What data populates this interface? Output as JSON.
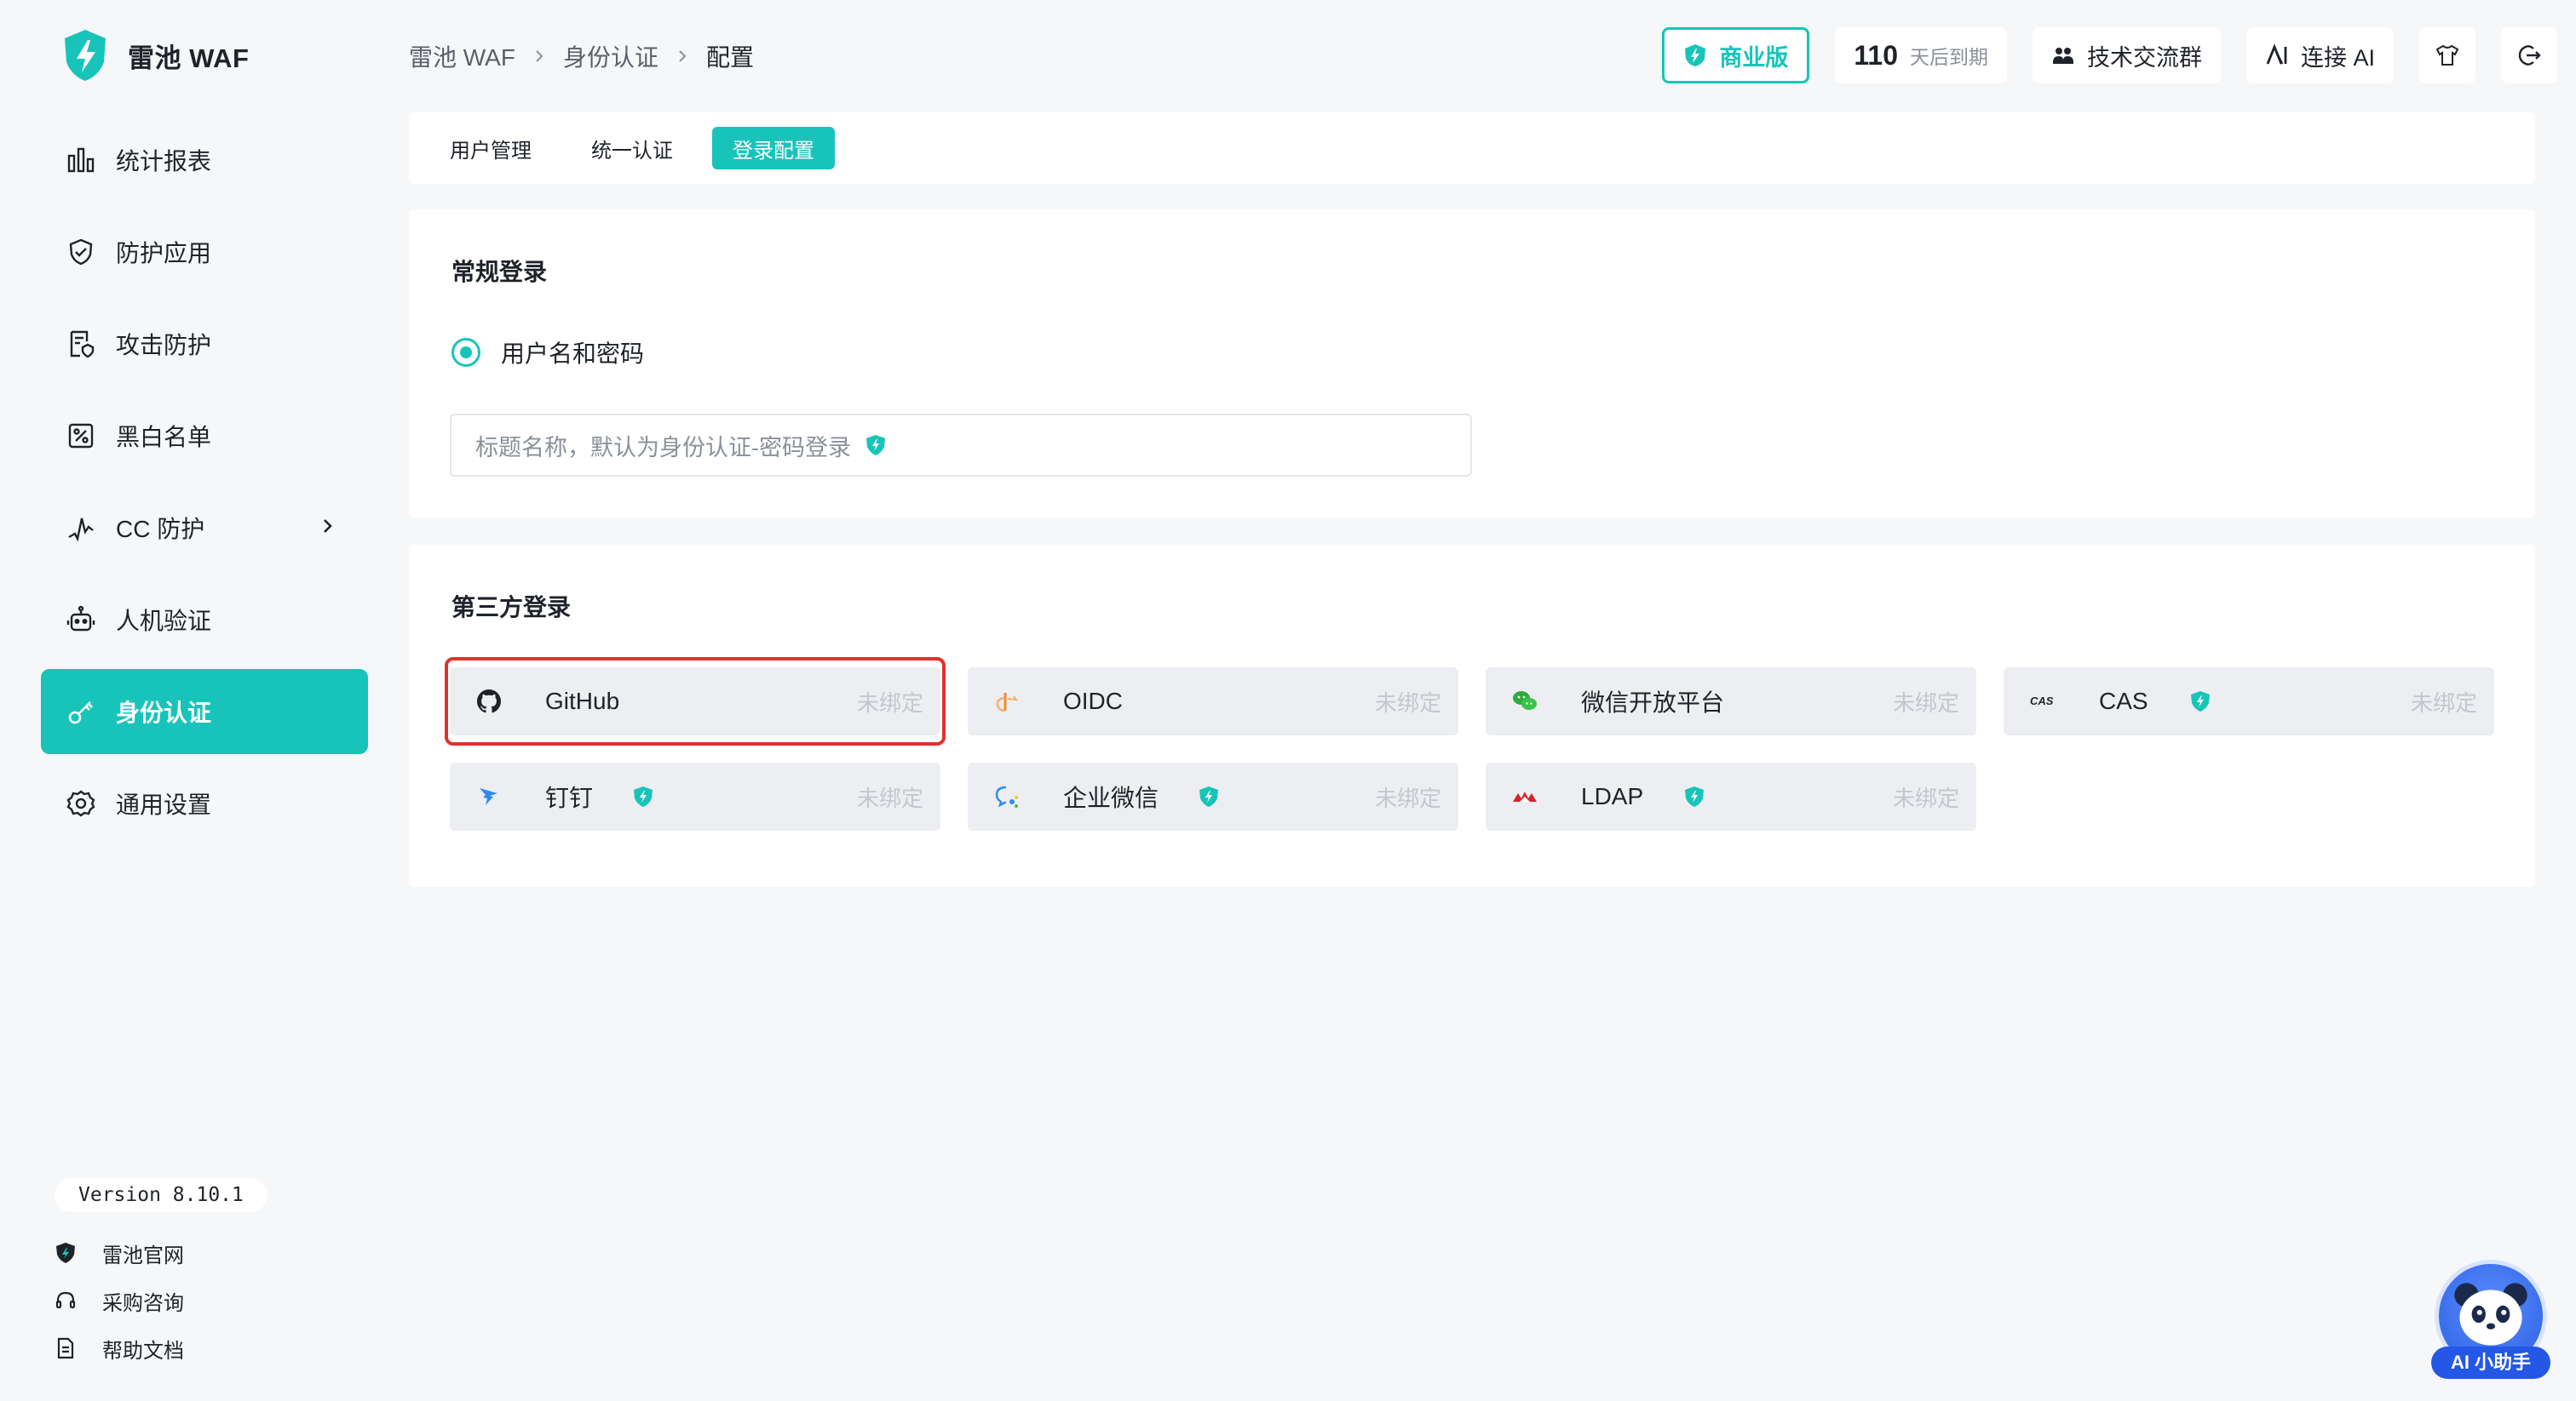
{
  "brand": {
    "name": "雷池 WAF",
    "color": "#18c4b9"
  },
  "sidebar": {
    "items": [
      {
        "label": "统计报表",
        "icon": "chart-icon"
      },
      {
        "label": "防护应用",
        "icon": "shield-icon"
      },
      {
        "label": "攻击防护",
        "icon": "document-shield-icon"
      },
      {
        "label": "黑白名单",
        "icon": "list-percent-icon"
      },
      {
        "label": "CC 防护",
        "icon": "pulse-icon"
      },
      {
        "label": "人机验证",
        "icon": "robot-icon"
      },
      {
        "label": "身份认证",
        "icon": "key-icon"
      },
      {
        "label": "通用设置",
        "icon": "settings-icon"
      }
    ],
    "active_index": 6,
    "version": "Version 8.10.1",
    "links": [
      {
        "label": "雷池官网",
        "icon": "shield-logo-icon"
      },
      {
        "label": "采购咨询",
        "icon": "headset-icon"
      },
      {
        "label": "帮助文档",
        "icon": "doc-icon"
      }
    ]
  },
  "breadcrumb": [
    "雷池 WAF",
    "身份认证",
    "配置"
  ],
  "topbar": {
    "edition": "商业版",
    "days_count": "110",
    "days_label": "天后到期",
    "community": "技术交流群",
    "connect_ai": "连接 AI"
  },
  "tabs": [
    "用户管理",
    "统一认证",
    "登录配置"
  ],
  "active_tab": 2,
  "regular_login": {
    "title": "常规登录",
    "option": "用户名和密码",
    "input_placeholder": "标题名称，默认为身份认证-密码登录"
  },
  "third_party": {
    "title": "第三方登录",
    "providers": [
      {
        "name": "GitHub",
        "status": "未绑定",
        "icon": "github-icon",
        "pro": false,
        "highlighted": true
      },
      {
        "name": "OIDC",
        "status": "未绑定",
        "icon": "oidc-icon",
        "pro": false
      },
      {
        "name": "微信开放平台",
        "status": "未绑定",
        "icon": "wechat-icon",
        "pro": false
      },
      {
        "name": "CAS",
        "status": "未绑定",
        "icon": "cas-icon",
        "pro": true
      },
      {
        "name": "钉钉",
        "status": "未绑定",
        "icon": "dingtalk-icon",
        "pro": true
      },
      {
        "name": "企业微信",
        "status": "未绑定",
        "icon": "wecom-icon",
        "pro": true
      },
      {
        "name": "LDAP",
        "status": "未绑定",
        "icon": "ldap-icon",
        "pro": true
      }
    ]
  },
  "assistant": {
    "label": "AI 小助手"
  },
  "colors": {
    "accent": "#18c4b9",
    "highlight": "#e0312b",
    "muted": "#c3c7ce"
  }
}
